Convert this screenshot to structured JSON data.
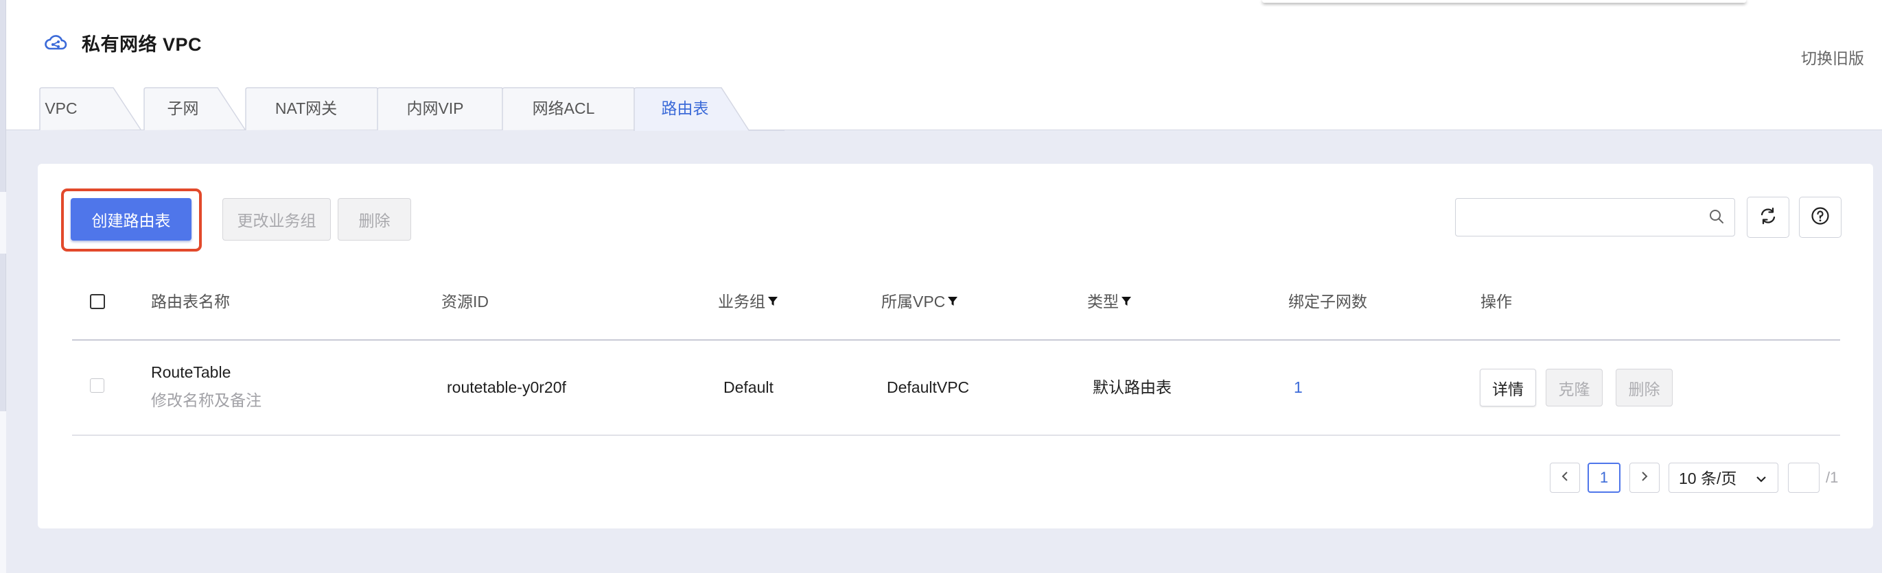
{
  "header": {
    "title": "私有网络 VPC",
    "switch_old": "切换旧版"
  },
  "tabs": [
    {
      "label": "VPC",
      "active": false
    },
    {
      "label": "子网",
      "active": false
    },
    {
      "label": "NAT网关",
      "active": false
    },
    {
      "label": "内网VIP",
      "active": false
    },
    {
      "label": "网络ACL",
      "active": false
    },
    {
      "label": "路由表",
      "active": true
    }
  ],
  "toolbar": {
    "create_label": "创建路由表",
    "change_group_label": "更改业务组",
    "delete_label": "删除",
    "search_value": "",
    "search_placeholder": ""
  },
  "table": {
    "columns": [
      "路由表名称",
      "资源ID",
      "业务组",
      "所属VPC",
      "类型",
      "绑定子网数",
      "操作"
    ],
    "rows": [
      {
        "name": "RouteTable",
        "name_sub": "修改名称及备注",
        "resource_id": "routetable-y0r20f",
        "group": "Default",
        "vpc": "DefaultVPC",
        "type": "默认路由表",
        "subnet_count": "1",
        "actions": [
          "详情",
          "克隆",
          "删除"
        ]
      }
    ]
  },
  "pagination": {
    "current_page": "1",
    "page_size": "10 条/页",
    "jump_value": "",
    "total": "/1"
  },
  "colors": {
    "primary": "#4f76ea",
    "link": "#3b6ad8",
    "highlight": "#e2492b"
  }
}
